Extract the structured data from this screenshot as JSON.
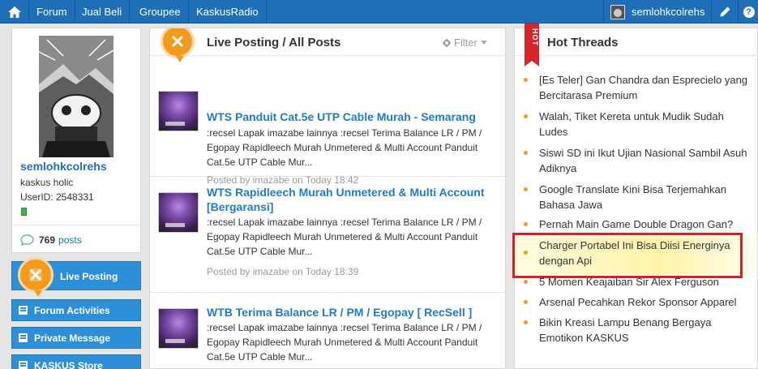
{
  "topbar": {
    "nav": [
      "Forum",
      "Jual Beli",
      "Groupee",
      "KaskusRadio"
    ],
    "username": "semlohkcolrehs"
  },
  "profile": {
    "username": "semlohkcolrehs",
    "rank": "kaskus holic",
    "user_id": "UserID: 2548331",
    "post_count": "769",
    "posts_label": "posts"
  },
  "sidebar": {
    "live_posting": "Live Posting",
    "forum_activities": "Forum Activities",
    "private_message": "Private Message",
    "kaskus_store": "KASKUS Store"
  },
  "live": {
    "title": "Live Posting / All Posts",
    "filter": "Filter",
    "posts": [
      {
        "title": "WTS Panduit Cat.5e UTP Cable Murah - Semarang",
        "excerpt": ":recsel Lapak imazabe lainnya :recsel Terima Balance LR / PM / Egopay Rapidleech Murah Unmetered & Multi Account Panduit Cat.5e UTP Cable Mur...",
        "meta": "Posted by imazabe on Today 18:42"
      },
      {
        "title": "WTS Rapidleech Murah Unmetered & Multi Account [Bergaransi]",
        "excerpt": ":recsel Lapak imazabe lainnya :recsel Terima Balance LR / PM / Egopay Rapidleech Murah Unmetered & Multi Account Panduit Cat.5e UTP Cable Mur...",
        "meta": "Posted by imazabe on Today 18:39"
      },
      {
        "title": "WTB Terima Balance LR / PM / Egopay [ RecSell ]",
        "excerpt": ":recsel Lapak imazabe lainnya :recsel Terima Balance LR / PM / Egopay Rapidleech Murah Unmetered & Multi Account Panduit Cat.5e UTP Cable Mur...",
        "meta": ""
      }
    ]
  },
  "hot": {
    "title": "Hot Threads",
    "ribbon": "HOT",
    "threads": [
      "[Es Teler] Gan Chandra dan Esprecielo yang Bercitarasa Premium",
      "Walah, Tiket Kereta untuk Mudik Sudah Ludes",
      "Siswi SD ini Ikut Ujian Nasional Sambil Asuh Adiknya",
      "Google Translate Kini Bisa Terjemahkan Bahasa Jawa",
      "Pernah Main Game Double Dragon Gan?",
      "Charger Portabel Ini Bisa Diisi Energinya dengan Api",
      "5 Momen Keajaiban Sir Alex Ferguson",
      "Arsenal Pecahkan Rekor Sponsor Apparel",
      "Bikin Kreasi Lampu Benang Bergaya Emotikon KASKUS"
    ]
  },
  "colors": {
    "topbar": "#1e6fb8",
    "link": "#1e7bc4",
    "accent_orange": "#f39a1c",
    "highlight_border": "#d22229"
  },
  "icons": [
    "home-icon",
    "pencil-icon",
    "help-icon",
    "speech-bubble-icon",
    "live-posting-logo-icon",
    "gear-icon",
    "hot-ribbon-icon",
    "list-icon"
  ]
}
